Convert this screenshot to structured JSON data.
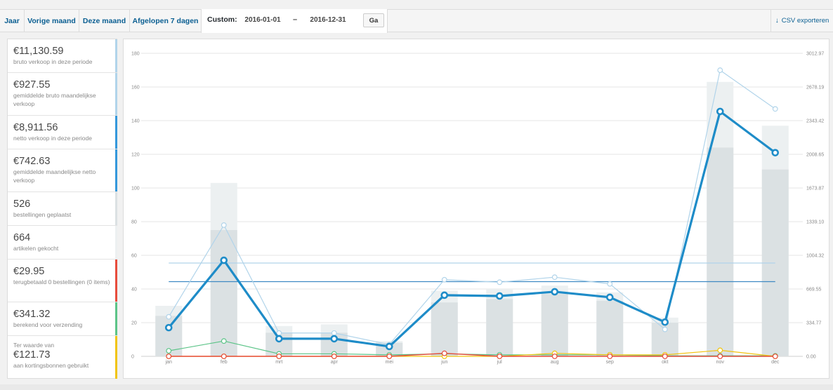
{
  "tabs": {
    "year": "Jaar",
    "last_month": "Vorige maand",
    "this_month": "Deze maand",
    "last_7_days": "Afgelopen 7 dagen",
    "custom_label": "Custom:",
    "start_date": "2016-01-01",
    "separator": "–",
    "end_date": "2016-12-31",
    "go_button": "Ga",
    "export_label": "CSV exporteren"
  },
  "legend": [
    {
      "value": "€11,130.59",
      "desc": "bruto verkoop in deze periode",
      "color": "#b1d4ea"
    },
    {
      "value": "€927.55",
      "desc": "gemiddelde bruto maandelijkse verkoop",
      "color": "#b1d4ea"
    },
    {
      "value": "€8,911.56",
      "desc": "netto verkoop in deze periode",
      "color": "#3498db"
    },
    {
      "value": "€742.63",
      "desc": "gemiddelde maandelijkse netto verkoop",
      "color": "#3498db"
    },
    {
      "value": "526",
      "desc": "bestellingen geplaatst",
      "color": "#dbe1e3"
    },
    {
      "value": "664",
      "desc": "artikelen gekocht",
      "color": "#ecf0f1"
    },
    {
      "value": "€29.95",
      "desc": "terugbetaald 0 bestellingen (0 items)",
      "color": "#e74c3c"
    },
    {
      "value": "€341.32",
      "desc": "berekend voor verzending",
      "color": "#5cc488"
    },
    {
      "pre": "Ter waarde van",
      "value": "€121.73",
      "desc": "aan kortingsbonnen gebruikt",
      "color": "#f1c40f"
    }
  ],
  "chart_data": {
    "type": "bar",
    "categories": [
      "jan",
      "feb",
      "mrt",
      "apr",
      "mei",
      "jun",
      "jul",
      "aug",
      "sep",
      "okt",
      "nov",
      "dec"
    ],
    "y_left": {
      "ticks": [
        0,
        20,
        40,
        60,
        80,
        100,
        120,
        140,
        160,
        180
      ],
      "range": [
        0,
        180
      ]
    },
    "y_right": {
      "ticks": [
        "0.00",
        "334.77",
        "669.55",
        "1004.32",
        "1339.10",
        "1673.87",
        "2008.65",
        "2343.42",
        "2678.19",
        "3012.97"
      ],
      "range": [
        0,
        3012.97
      ]
    },
    "series": [
      {
        "name": "bestellingen geplaatst",
        "type": "bar",
        "axis": "left",
        "color": "#dbe1e3",
        "values": [
          24,
          75,
          14,
          14,
          8,
          32,
          34,
          37,
          33,
          20,
          124,
          111
        ]
      },
      {
        "name": "artikelen gekocht",
        "type": "bar",
        "axis": "left",
        "color": "#ecf0f1",
        "values": [
          30,
          103,
          18,
          19,
          9,
          39,
          40,
          42,
          38,
          23,
          163,
          137
        ]
      },
      {
        "name": "bruto verkoop",
        "type": "line",
        "axis": "right",
        "color": "#b1d4ea",
        "width": 1.2,
        "values": [
          393,
          1305,
          232,
          232,
          117,
          762,
          737,
          787,
          720,
          268,
          2845,
          2460
        ]
      },
      {
        "name": "netto verkoop",
        "type": "line",
        "axis": "right",
        "color": "#1e8cc8",
        "width": 3.2,
        "values": [
          285,
          955,
          175,
          175,
          98,
          608,
          600,
          642,
          587,
          340,
          2435,
          2025
        ]
      },
      {
        "name": "gemiddelde bruto verkoop",
        "type": "hline",
        "axis": "right",
        "color": "#b1d4ea",
        "width": 1.3,
        "value": 927.55
      },
      {
        "name": "gemiddelde netto verkoop",
        "type": "hline",
        "axis": "right",
        "color": "#3f8ac3",
        "width": 1.3,
        "value": 742.63
      },
      {
        "name": "verzending",
        "type": "line",
        "axis": "right",
        "color": "#5cc488",
        "width": 1.2,
        "values": [
          55,
          152,
          25,
          25,
          15,
          25,
          15,
          15,
          15,
          5,
          5,
          5
        ]
      },
      {
        "name": "kortingsbonnen",
        "type": "line",
        "axis": "right",
        "color": "#f1c40f",
        "width": 1.2,
        "values": [
          0,
          0,
          0,
          0,
          0,
          0,
          0,
          30,
          15,
          15,
          60,
          0
        ]
      },
      {
        "name": "terugbetaald",
        "type": "line",
        "axis": "right",
        "color": "#e74c3c",
        "width": 1.4,
        "values": [
          0,
          0,
          0,
          0,
          0,
          30,
          0,
          0,
          0,
          0,
          0,
          0
        ]
      }
    ]
  }
}
